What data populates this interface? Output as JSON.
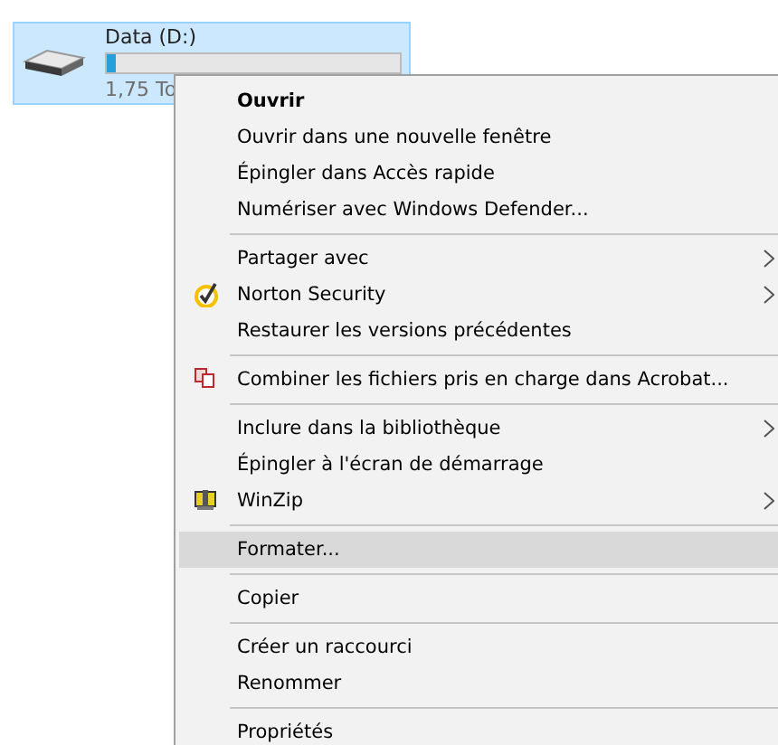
{
  "drive": {
    "name": "Data (D:)",
    "level": 0.03,
    "size": "1,75 To",
    "selected": true
  },
  "menu": [
    {
      "kind": "item",
      "label": "Ouvrir",
      "bold": true,
      "submenu": false,
      "selected": false
    },
    {
      "kind": "item",
      "label": "Ouvrir dans une nouvelle fenêtre",
      "bold": false,
      "submenu": false,
      "selected": false
    },
    {
      "kind": "item",
      "label": "Épingler dans Accès rapide",
      "bold": false,
      "submenu": false,
      "selected": false
    },
    {
      "kind": "item",
      "label": "Numériser avec Windows Defender...",
      "bold": false,
      "submenu": false,
      "selected": false
    },
    {
      "kind": "separator"
    },
    {
      "kind": "item",
      "label": "Partager avec",
      "bold": false,
      "submenu": true,
      "selected": false
    },
    {
      "kind": "checked-item",
      "label": "Norton Security",
      "bold": false,
      "submenu": true,
      "selected": false
    },
    {
      "kind": "item",
      "label": "Restaurer les versions précédentes",
      "bold": false,
      "submenu": false,
      "selected": false
    },
    {
      "kind": "separator"
    },
    {
      "kind": "document-item",
      "label": "Combiner les fichiers pris en charge dans Acrobat...",
      "bold": false,
      "submenu": false,
      "selected": false
    },
    {
      "kind": "separator"
    },
    {
      "kind": "item",
      "label": "Inclure dans la bibliothèque",
      "bold": false,
      "submenu": true,
      "selected": false
    },
    {
      "kind": "item",
      "label": "Épingler à l'écran de démarrage",
      "bold": false,
      "submenu": false,
      "selected": false
    },
    {
      "kind": "archive-item",
      "label": "WinZip",
      "bold": false,
      "submenu": true,
      "selected": false
    },
    {
      "kind": "separator"
    },
    {
      "kind": "item",
      "label": "Formater...",
      "bold": false,
      "submenu": false,
      "selected": true
    },
    {
      "kind": "separator"
    },
    {
      "kind": "item",
      "label": "Copier",
      "bold": false,
      "submenu": false,
      "selected": false
    },
    {
      "kind": "separator"
    },
    {
      "kind": "item",
      "label": "Créer un raccourci",
      "bold": false,
      "submenu": false,
      "selected": false
    },
    {
      "kind": "item",
      "label": "Renommer",
      "bold": false,
      "submenu": false,
      "selected": false
    },
    {
      "kind": "separator"
    },
    {
      "kind": "item",
      "label": "Propriétés",
      "bold": false,
      "submenu": false,
      "selected": false
    }
  ]
}
